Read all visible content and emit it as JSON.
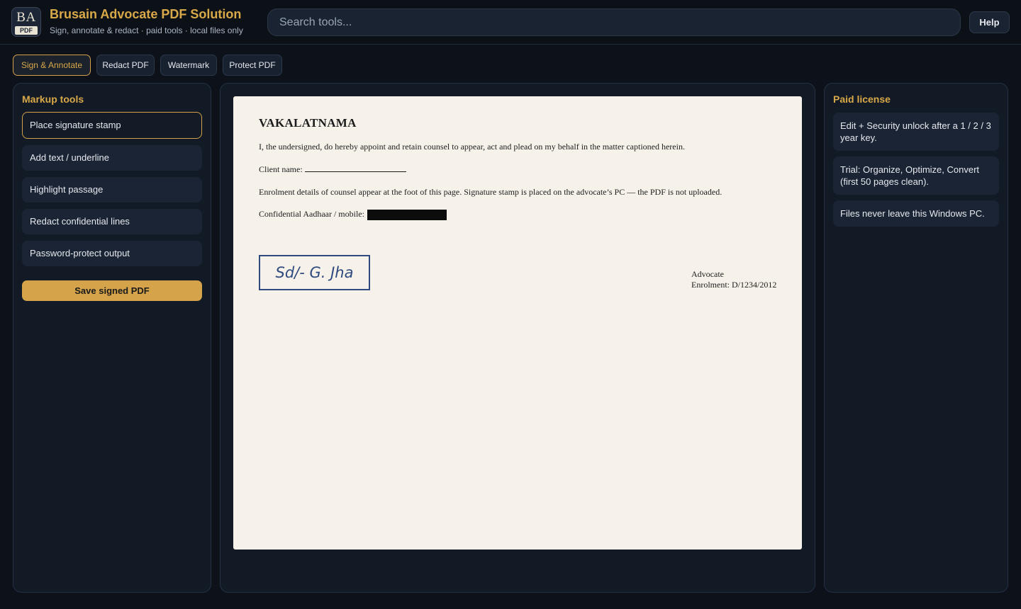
{
  "header": {
    "logo_top": "BA",
    "logo_bottom": "PDF",
    "title": "Brusain Advocate PDF Solution",
    "subtitle": "Sign, annotate & redact · paid tools · local files only",
    "search_placeholder": "Search tools...",
    "help_label": "Help"
  },
  "tabs": [
    {
      "label": "Sign & Annotate",
      "active": true
    },
    {
      "label": "Redact PDF",
      "active": false
    },
    {
      "label": "Watermark",
      "active": false
    },
    {
      "label": "Protect PDF",
      "active": false
    }
  ],
  "markup": {
    "title": "Markup tools",
    "items": [
      {
        "label": "Place signature stamp",
        "active": true
      },
      {
        "label": "Add text / underline",
        "active": false
      },
      {
        "label": "Highlight passage",
        "active": false
      },
      {
        "label": "Redact confidential lines",
        "active": false
      },
      {
        "label": "Password-protect output",
        "active": false
      }
    ],
    "save_label": "Save signed PDF"
  },
  "document": {
    "title": "VAKALATNAMA",
    "para1": "I, the undersigned, do hereby appoint and retain counsel to appear, act and plead on my behalf in the matter captioned herein.",
    "client_label": "Client name:",
    "para2": "Enrolment details of counsel appear at the foot of this page. Signature stamp is placed on the advocate’s PC — the PDF is not uploaded.",
    "confidential_label": "Confidential Aadhaar / mobile:",
    "stamp_text": "Sd/- G. Jha",
    "advocate_label": "Advocate",
    "enrolment": "Enrolment: D/1234/2012"
  },
  "license": {
    "title": "Paid license",
    "items": [
      "Edit + Security unlock after a 1 / 2 / 3 year key.",
      "Trial: Organize, Optimize, Convert (first 50 pages clean).",
      "Files never leave this Windows PC."
    ]
  },
  "colors": {
    "accent": "#d9a848",
    "background": "#0d121a",
    "panel": "#121a26",
    "paper": "#f6f2ea",
    "stamp": "#2e4a7e"
  }
}
